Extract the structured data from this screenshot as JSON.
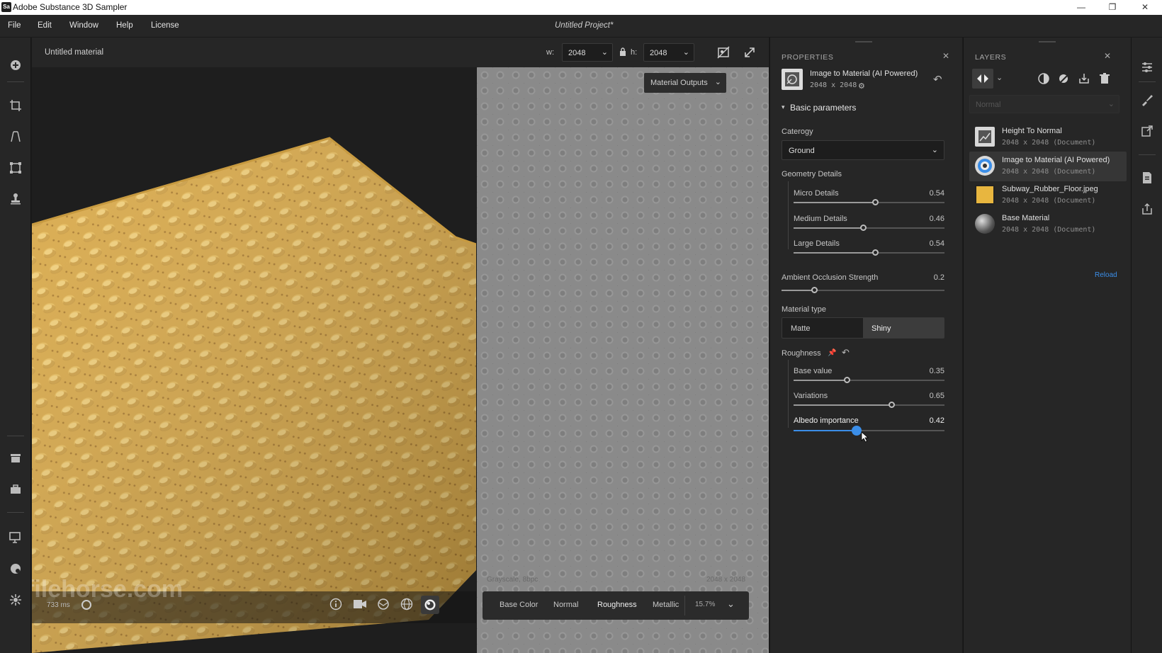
{
  "window": {
    "title": "Adobe Substance 3D Sampler",
    "logo": "Sa"
  },
  "menu": {
    "items": [
      "File",
      "Edit",
      "Window",
      "Help",
      "License"
    ],
    "project": "Untitled Project*"
  },
  "viewport_header": {
    "material_name": "Untitled material",
    "w_label": "w:",
    "w_value": "2048",
    "h_label": "h:",
    "h_value": "2048"
  },
  "viewport_2d": {
    "outputs_label": "Material Outputs",
    "format_label": "Grayscale, 8bpc",
    "size_label": "2048 x 2048",
    "channels": [
      "Base Color",
      "Normal",
      "Roughness",
      "Metallic"
    ],
    "active_channel": "Roughness",
    "zoom": "15.7%"
  },
  "viewport_3d": {
    "render_time": "733 ms",
    "watermark": "filehorse.com"
  },
  "properties": {
    "title": "PROPERTIES",
    "node_name": "Image to Material (AI Powered)",
    "node_size": "2048 x 2048",
    "section": "Basic parameters",
    "category_label": "Caterogy",
    "category_value": "Ground",
    "geometry_label": "Geometry Details",
    "micro": {
      "label": "Micro Details",
      "value": "0.54",
      "level": 0.54
    },
    "medium": {
      "label": "Medium Details",
      "value": "0.46",
      "level": 0.46
    },
    "large": {
      "label": "Large Details",
      "value": "0.54",
      "level": 0.54
    },
    "ao": {
      "label": "Ambient Occlusion Strength",
      "value": "0.2",
      "level": 0.2
    },
    "material_type_label": "Material type",
    "matte": "Matte",
    "shiny": "Shiny",
    "active_type": "Shiny",
    "roughness_label": "Roughness",
    "base": {
      "label": "Base value",
      "value": "0.35",
      "level": 0.35
    },
    "variations": {
      "label": "Variations",
      "value": "0.65",
      "level": 0.65
    },
    "albedo": {
      "label": "Albedo importance",
      "value": "0.42",
      "level": 0.42
    }
  },
  "layers": {
    "title": "LAYERS",
    "blend_mode": "Normal",
    "reload": "Reload",
    "items": [
      {
        "name": "Height To Normal",
        "size": "2048 x 2048 (Document)"
      },
      {
        "name": "Image to Material (AI Powered)",
        "size": "2048 x 2048 (Document)"
      },
      {
        "name": "Subway_Rubber_Floor.jpeg",
        "size": "2048 x 2048 (Document)"
      },
      {
        "name": "Base Material",
        "size": "2048 x 2048 (Document)"
      }
    ]
  },
  "colors": {
    "accent": "#3b8ee8",
    "material": "#d9a846",
    "panel": "#262626"
  }
}
